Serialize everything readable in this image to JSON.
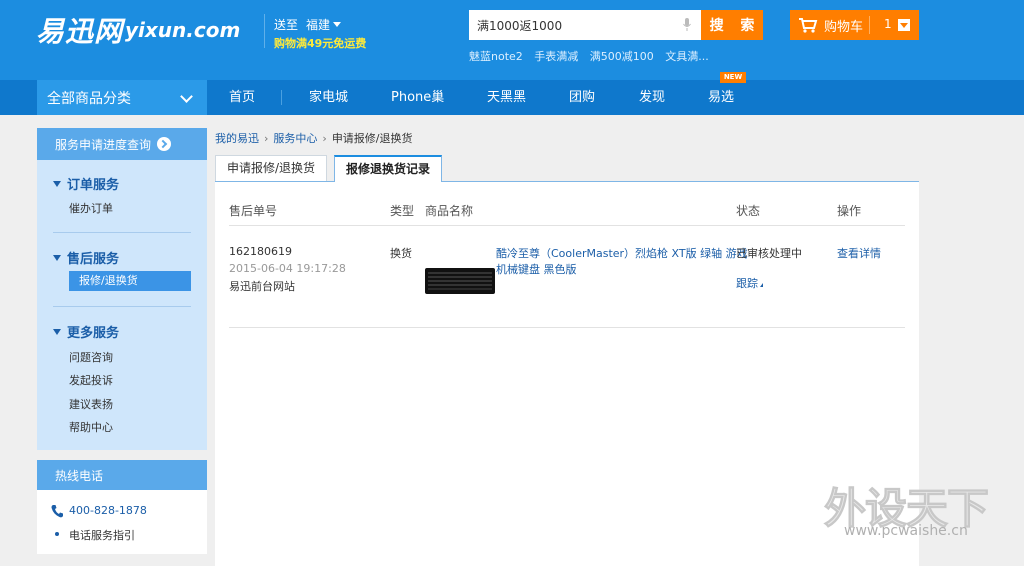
{
  "header": {
    "logo_cn": "易迅网",
    "logo_en": "yixun.com",
    "ship_to_label": "送至",
    "ship_region": "福建",
    "promo": "购物满49元免运费",
    "search": {
      "value": "满1000返1000",
      "button_label": "搜 索",
      "hot_keywords": [
        "魅蓝note2",
        "手表满减",
        "满500减100",
        "文具满..."
      ]
    },
    "cart": {
      "label": "购物车",
      "count": "1"
    }
  },
  "nav": {
    "category_label": "全部商品分类",
    "items": [
      "首页",
      "家电城",
      "Phone巢",
      "天黑黑",
      "团购",
      "发现",
      "易选"
    ],
    "new_badge": "NEW"
  },
  "sidebar": {
    "title": "服务申请进度查询",
    "groups": [
      {
        "title": "订单服务",
        "items": [
          "催办订单"
        ]
      },
      {
        "title": "售后服务",
        "items": [
          "报修/退换货"
        ]
      },
      {
        "title": "更多服务",
        "items": [
          "问题咨询",
          "发起投诉",
          "建议表扬",
          "帮助中心"
        ]
      }
    ],
    "hotline": {
      "title": "热线电话",
      "phone": "400-828-1878",
      "guide": "电话服务指引"
    }
  },
  "breadcrumb": [
    "我的易迅",
    "服务中心",
    "申请报修/退换货"
  ],
  "tabs": [
    "申请报修/退换货",
    "报修退换货记录"
  ],
  "table": {
    "headers": [
      "售后单号",
      "类型",
      "商品名称",
      "状态",
      "操作"
    ],
    "rows": [
      {
        "order_no": "162180619",
        "datetime": "2015-06-04 19:17:28",
        "source": "易迅前台网站",
        "type": "换货",
        "product_line1": "酷冷至尊（CoolerMaster）烈焰枪 XT版 绿轴 游戏",
        "product_line2": "机械键盘 黑色版",
        "status": "已审核处理中",
        "track": "跟踪",
        "action": "查看详情"
      }
    ]
  },
  "watermark": {
    "cn": "外设天下",
    "url": "www.pcwaishe.cn"
  },
  "colors": {
    "header_blue": "#1c8de0",
    "nav_blue": "#0f78cc",
    "accent_orange": "#ff7e00",
    "link_blue": "#1b5ea8"
  }
}
